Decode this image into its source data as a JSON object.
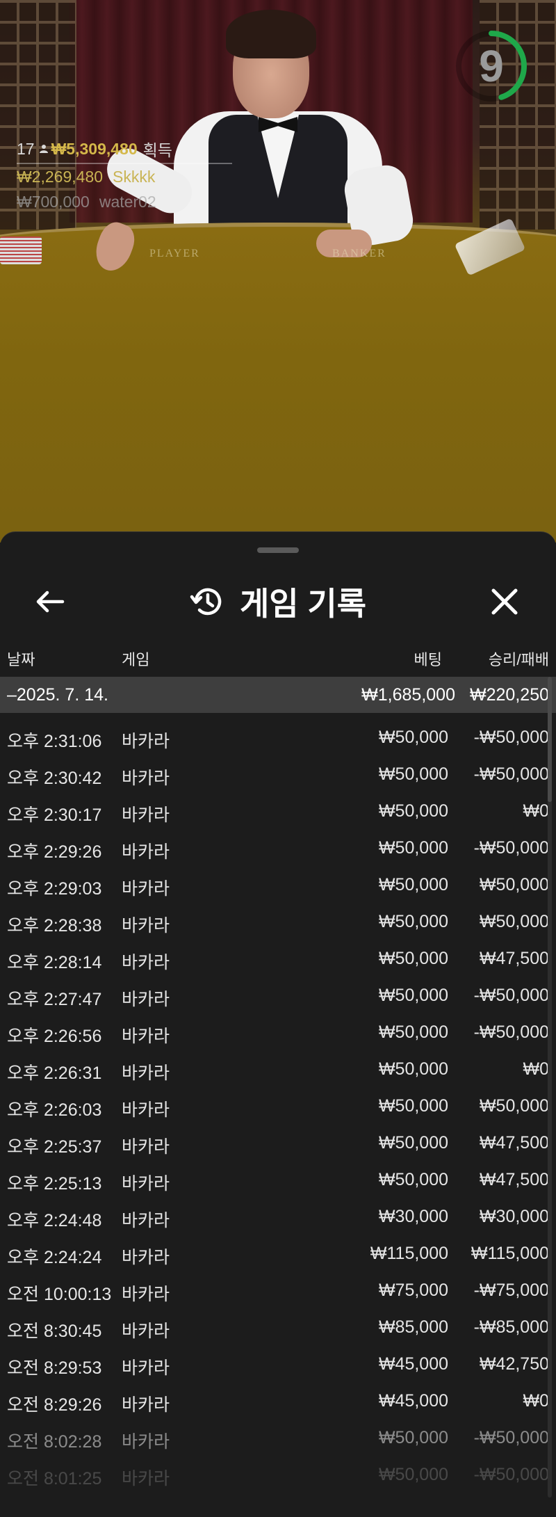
{
  "live": {
    "timer": "9",
    "timer_progress": 0.45,
    "timer_color": "#1fa84a",
    "felt_left": "PLAYER",
    "felt_right": "BANKER",
    "winners": [
      {
        "rank": "17",
        "amount": "₩5,309,480",
        "label": "획득",
        "icon": "person-icon"
      },
      {
        "amount": "₩2,269,480",
        "name": "Skkkk"
      },
      {
        "amount": "₩700,000",
        "name": "water02"
      }
    ]
  },
  "panel": {
    "title": "게임 기록",
    "back_icon": "arrow-left-icon",
    "history_icon": "history-icon",
    "close_icon": "close-icon",
    "columns": {
      "date": "날짜",
      "game": "게임",
      "bet": "베팅",
      "win_loss": "승리/패배"
    },
    "day": {
      "date": "–2025. 7. 14.",
      "bet_total": "₩1,685,000",
      "win_total": "₩220,250"
    },
    "rows": [
      {
        "time": "오후 2:31:06",
        "game": "바카라",
        "bet": "₩50,000",
        "result": "-₩50,000"
      },
      {
        "time": "오후 2:30:42",
        "game": "바카라",
        "bet": "₩50,000",
        "result": "-₩50,000"
      },
      {
        "time": "오후 2:30:17",
        "game": "바카라",
        "bet": "₩50,000",
        "result": "₩0"
      },
      {
        "time": "오후 2:29:26",
        "game": "바카라",
        "bet": "₩50,000",
        "result": "-₩50,000"
      },
      {
        "time": "오후 2:29:03",
        "game": "바카라",
        "bet": "₩50,000",
        "result": "₩50,000"
      },
      {
        "time": "오후 2:28:38",
        "game": "바카라",
        "bet": "₩50,000",
        "result": "₩50,000"
      },
      {
        "time": "오후 2:28:14",
        "game": "바카라",
        "bet": "₩50,000",
        "result": "₩47,500"
      },
      {
        "time": "오후 2:27:47",
        "game": "바카라",
        "bet": "₩50,000",
        "result": "-₩50,000"
      },
      {
        "time": "오후 2:26:56",
        "game": "바카라",
        "bet": "₩50,000",
        "result": "-₩50,000"
      },
      {
        "time": "오후 2:26:31",
        "game": "바카라",
        "bet": "₩50,000",
        "result": "₩0"
      },
      {
        "time": "오후 2:26:03",
        "game": "바카라",
        "bet": "₩50,000",
        "result": "₩50,000"
      },
      {
        "time": "오후 2:25:37",
        "game": "바카라",
        "bet": "₩50,000",
        "result": "₩47,500"
      },
      {
        "time": "오후 2:25:13",
        "game": "바카라",
        "bet": "₩50,000",
        "result": "₩47,500"
      },
      {
        "time": "오후 2:24:48",
        "game": "바카라",
        "bet": "₩30,000",
        "result": "₩30,000"
      },
      {
        "time": "오후 2:24:24",
        "game": "바카라",
        "bet": "₩115,000",
        "result": "₩115,000"
      },
      {
        "time": "오전 10:00:13",
        "game": "바카라",
        "bet": "₩75,000",
        "result": "-₩75,000"
      },
      {
        "time": "오전 8:30:45",
        "game": "바카라",
        "bet": "₩85,000",
        "result": "-₩85,000"
      },
      {
        "time": "오전 8:29:53",
        "game": "바카라",
        "bet": "₩45,000",
        "result": "₩42,750"
      },
      {
        "time": "오전 8:29:26",
        "game": "바카라",
        "bet": "₩45,000",
        "result": "₩0"
      },
      {
        "time": "오전 8:02:28",
        "game": "바카라",
        "bet": "₩50,000",
        "result": "-₩50,000"
      },
      {
        "time": "오전 8:01:25",
        "game": "바카라",
        "bet": "₩50,000",
        "result": "-₩50,000"
      }
    ]
  }
}
